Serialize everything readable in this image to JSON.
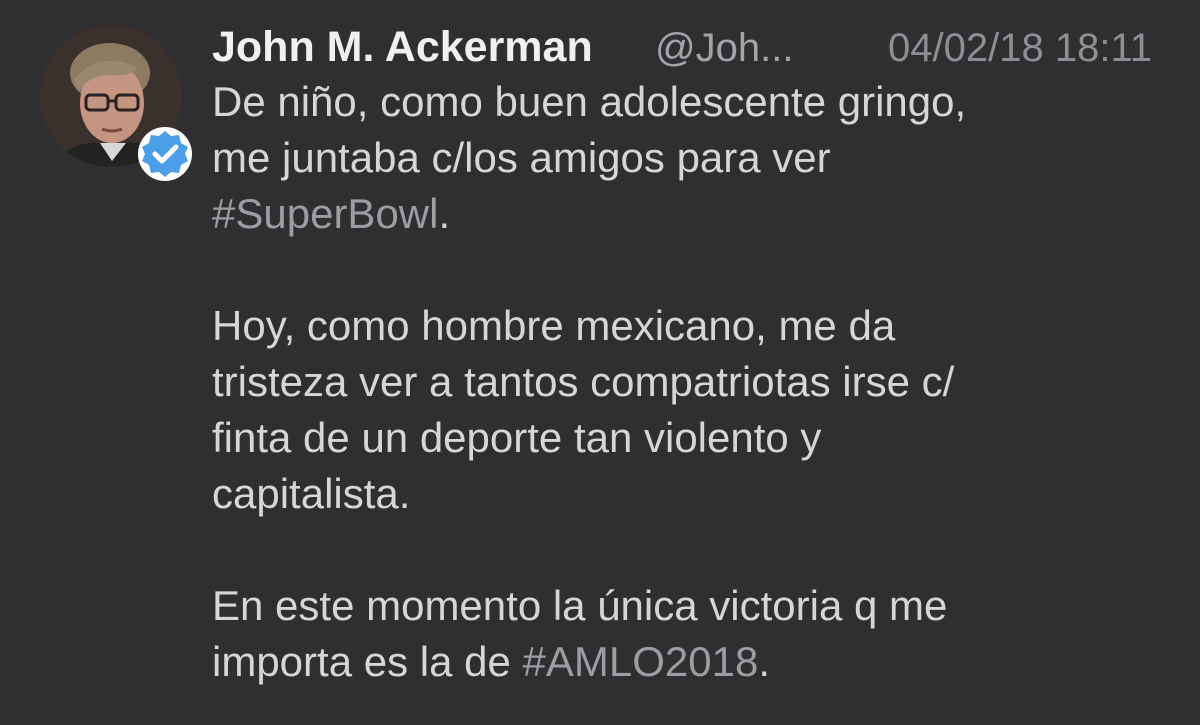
{
  "tweet": {
    "author_name": "John M. Ackerman",
    "handle": "@Joh...",
    "timestamp": "04/02/18 18:11",
    "paragraphs": [
      {
        "line1": "De niño, como buen adolescente gringo,",
        "line2": "me juntaba c/los amigos para ver",
        "hashtag": "#SuperBowl",
        "after": "."
      },
      {
        "line1": "Hoy, como hombre mexicano, me da",
        "line2": "tristeza ver a tantos compatriotas irse c/",
        "line3": "finta de un deporte tan violento y",
        "line4": "capitalista."
      },
      {
        "line1": "En este momento la única victoria q me",
        "before": "importa es la de ",
        "hashtag": "#AMLO2018",
        "after": "."
      }
    ]
  },
  "icons": {
    "avatar": "avatar",
    "verified": "verified-badge-icon"
  },
  "colors": {
    "background": "#2f2f31",
    "text": "#d6d6d8",
    "name": "#f0f0f2",
    "muted": "#8e8e93",
    "hashtag": "#9c9ca1",
    "verified": "#1da1f2"
  }
}
